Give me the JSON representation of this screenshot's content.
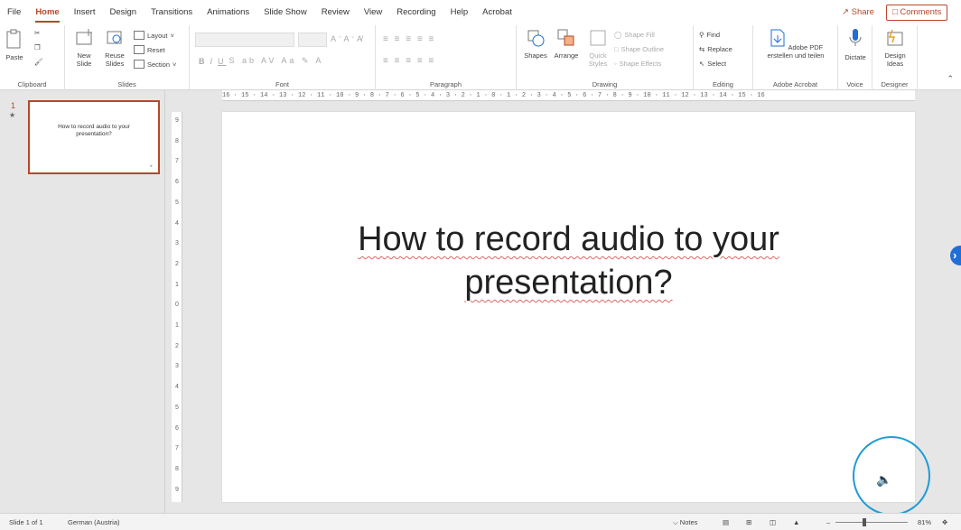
{
  "tabs": [
    "File",
    "Home",
    "Insert",
    "Design",
    "Transitions",
    "Animations",
    "Slide Show",
    "Review",
    "View",
    "Recording",
    "Help",
    "Acrobat"
  ],
  "active_tab": "Home",
  "share_label": "Share",
  "comments_label": "Comments",
  "ribbon": {
    "clipboard": {
      "paste": "Paste",
      "label": "Clipboard"
    },
    "slides": {
      "new_slide_1": "New",
      "new_slide_2": "Slide",
      "reuse_1": "Reuse",
      "reuse_2": "Slides",
      "layout": "Layout",
      "reset": "Reset",
      "section": "Section",
      "label": "Slides"
    },
    "font": {
      "label": "Font"
    },
    "paragraph": {
      "label": "Paragraph"
    },
    "drawing": {
      "shapes": "Shapes",
      "arrange": "Arrange",
      "quick_1": "Quick",
      "quick_2": "Styles",
      "shape_fill": "Shape Fill",
      "shape_outline": "Shape Outline",
      "shape_effects": "Shape Effects",
      "label": "Drawing"
    },
    "editing": {
      "find": "Find",
      "replace": "Replace",
      "select": "Select",
      "label": "Editing"
    },
    "acrobat": {
      "btn_1": "Adobe PDF",
      "btn_2": "erstellen und teilen",
      "label": "Adobe Acrobat"
    },
    "voice": {
      "dictate": "Dictate",
      "label": "Voice"
    },
    "designer": {
      "btn_1": "Design",
      "btn_2": "Ideas",
      "label": "Designer"
    }
  },
  "thumbnail": {
    "number": "1",
    "title": "How to record audio to your presentation?"
  },
  "ruler": {
    "horizontal": "16 · 15 · 14 · 13 · 12 · 11 · 10 · 9 · 8 · 7 · 6 · 5 · 4 · 3 · 2 · 1 · 0 · 1 · 2 · 3 · 4 · 5 · 6 · 7 · 8 · 9 · 10 · 11 · 12 · 13 · 14 · 15 · 16",
    "vertical": [
      "9",
      "8",
      "7",
      "6",
      "5",
      "4",
      "3",
      "2",
      "1",
      "0",
      "1",
      "2",
      "3",
      "4",
      "5",
      "6",
      "7",
      "8",
      "9"
    ]
  },
  "slide": {
    "title_line1": "How to record audio to your",
    "title_line2": "presentation?"
  },
  "status": {
    "slide_info": "Slide 1 of 1",
    "language": "German (Austria)",
    "notes": "Notes",
    "zoom": "81%"
  },
  "colors": {
    "accent": "#b7472a",
    "callout": "#1f9bd6"
  }
}
